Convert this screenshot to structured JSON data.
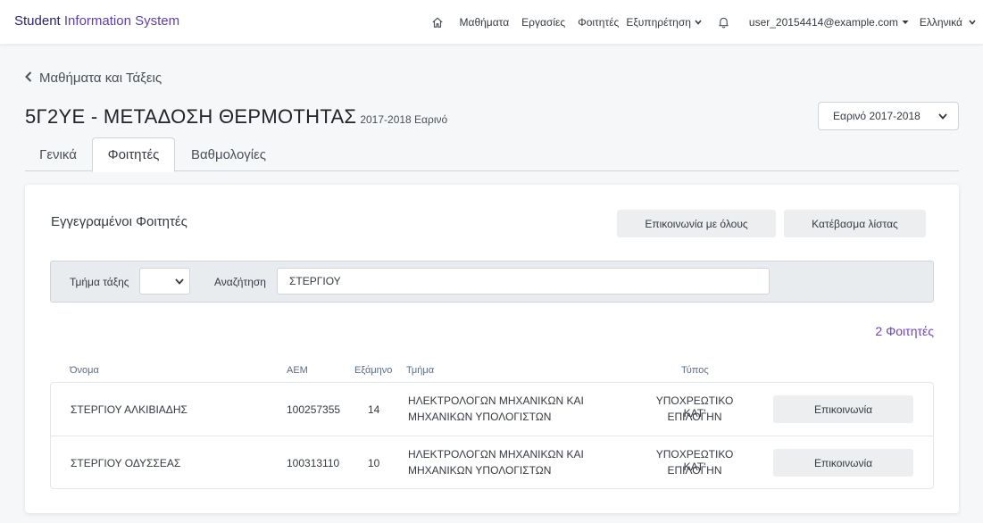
{
  "brand": {
    "part1": "Student",
    "part2": " Information System"
  },
  "nav": {
    "home_icon": "home-icon",
    "items": [
      "Μαθήματα",
      "Εργασίες",
      "Φοιτητές"
    ],
    "services": "Εξυπηρέτηση",
    "bell_icon": "bell-icon",
    "user": "user_20154414@example.com",
    "language": "Ελληνικά"
  },
  "back_link": "Μαθήματα και Τάξεις",
  "course": {
    "title": "5Γ2ΥΕ - ΜΕΤΑΔΟΣΗ ΘΕΡΜΟΤΗΤΑΣ",
    "subtitle": "2017-2018 Εαρινό"
  },
  "semester_select": "Εαρινό 2017-2018",
  "tabs": [
    "Γενικά",
    "Φοιτητές",
    "Βαθμολογίες"
  ],
  "active_tab": "Φοιτητές",
  "card": {
    "title": "Εγγεγραμένοι Φοιτητές",
    "contact_all": "Επικοινωνία με όλους",
    "download_list": "Κατέβασμα λίστας"
  },
  "filter": {
    "section_label": "Τμήμα τάξης",
    "section_value": "",
    "search_label": "Αναζήτηση",
    "search_value": "ΣΤΕΡΓΙΟΥ"
  },
  "count": "2 Φοιτητές",
  "table": {
    "headers": [
      "Όνομα",
      "ΑΕΜ",
      "Εξάμηνο",
      "Τμήμα",
      "Τύπος"
    ],
    "rows": [
      {
        "name": "ΣΤΕΡΓΙΟΥ ΑΛΚΙΒΙΑΔΗΣ",
        "aem": "100257355",
        "semester": "14",
        "dept_line1": "ΗΛΕΚΤΡΟΛΟΓΩΝ ΜΗΧΑΝΙΚΩΝ ΚΑΙ",
        "dept_line2": "ΜΗΧΑΝΙΚΩΝ ΥΠΟΛΟΓΙΣΤΩΝ",
        "type_line1": "ΥΠΟΧΡΕΩΤΙΚΟ ΚΑΤ'",
        "type_line2": "ΕΠΙΛΟΓΗΝ",
        "action": "Επικοινωνία"
      },
      {
        "name": "ΣΤΕΡΓΙΟΥ ΟΔΥΣΣΕΑΣ",
        "aem": "100313110",
        "semester": "10",
        "dept_line1": "ΗΛΕΚΤΡΟΛΟΓΩΝ ΜΗΧΑΝΙΚΩΝ ΚΑΙ",
        "dept_line2": "ΜΗΧΑΝΙΚΩΝ ΥΠΟΛΟΓΙΣΤΩΝ",
        "type_line1": "ΥΠΟΧΡΕΩΤΙΚΟ ΚΑΤ'",
        "type_line2": "ΕΠΙΛΟΓΗΝ",
        "action": "Επικοινωνία"
      }
    ]
  },
  "colors": {
    "brand": "#5b3fb5",
    "count": "#6f42c1",
    "button_bg": "#eceef0"
  }
}
